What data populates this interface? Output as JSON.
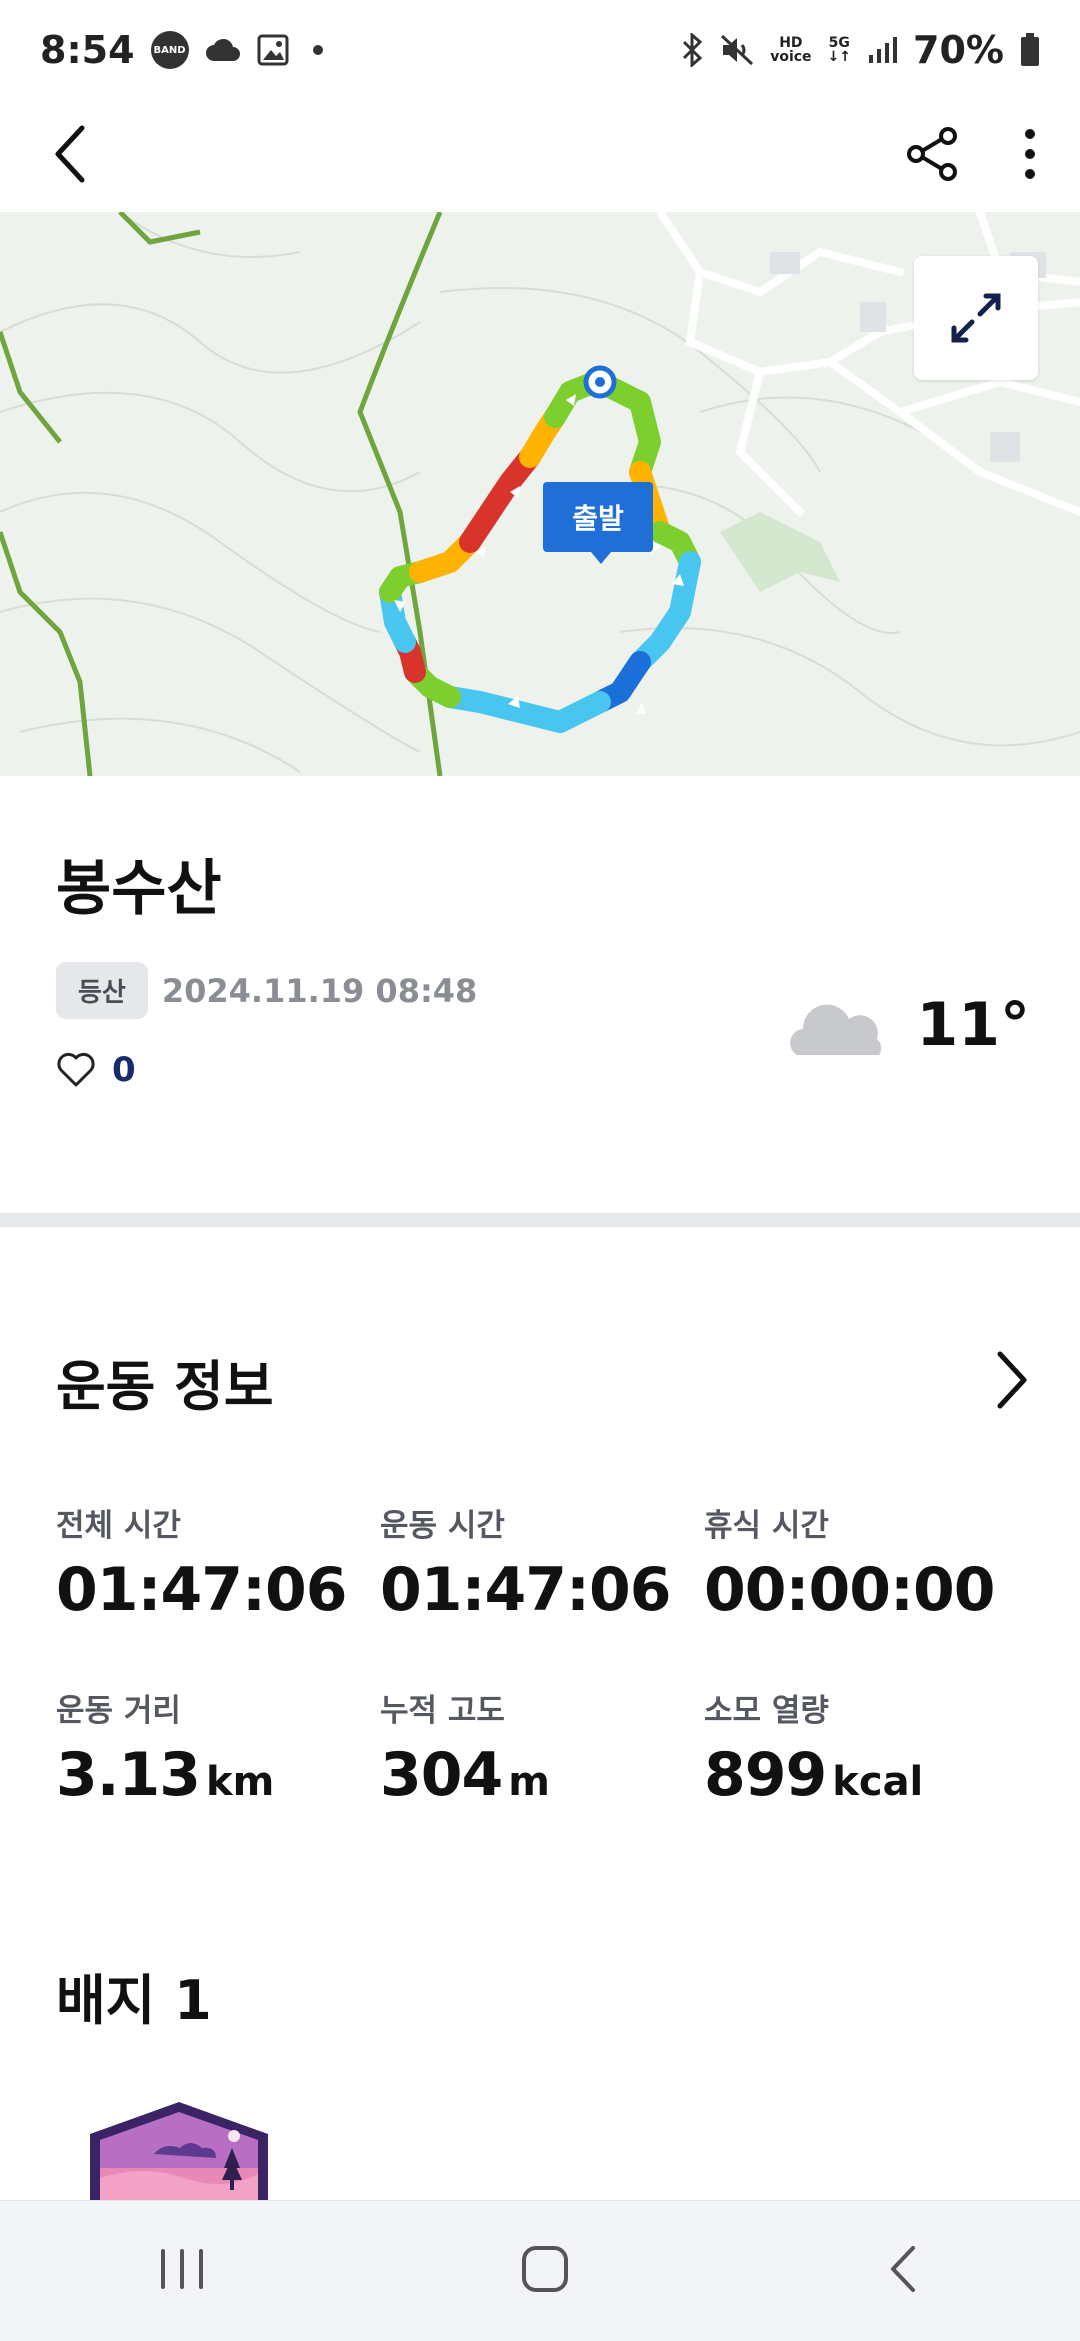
{
  "status_bar": {
    "time": "8:54",
    "band_badge": "BAND",
    "hd": "HD",
    "voice": "voice",
    "network": "5G",
    "battery": "70%"
  },
  "app_bar": {
    "back_icon": "chevron-left-icon",
    "share_icon": "share-icon",
    "more_icon": "more-vertical-icon"
  },
  "map": {
    "start_label": "출발",
    "expand_icon": "expand-icon"
  },
  "activity": {
    "title": "봉수산",
    "category": "등산",
    "datetime": "2024.11.19 08:48",
    "likes": "0",
    "temperature": "11°",
    "weather_icon": "cloud-icon"
  },
  "exercise_info": {
    "title": "운동 정보",
    "stats": [
      {
        "label": "전체 시간",
        "value": "01:47:06",
        "unit": ""
      },
      {
        "label": "운동 시간",
        "value": "01:47:06",
        "unit": ""
      },
      {
        "label": "휴식 시간",
        "value": "00:00:00",
        "unit": ""
      },
      {
        "label": "운동 거리",
        "value": "3.13",
        "unit": "km"
      },
      {
        "label": "누적 고도",
        "value": "304",
        "unit": "m"
      },
      {
        "label": "소모 열량",
        "value": "899",
        "unit": "kcal"
      }
    ]
  },
  "badges": {
    "title": "배지 1"
  },
  "colors": {
    "accent": "#1f6fd6",
    "route_green": "#7ccf2e",
    "route_orange": "#ffb300",
    "route_red": "#d9342b",
    "route_cyan": "#49c6f0",
    "route_blue": "#1a6fd8"
  }
}
